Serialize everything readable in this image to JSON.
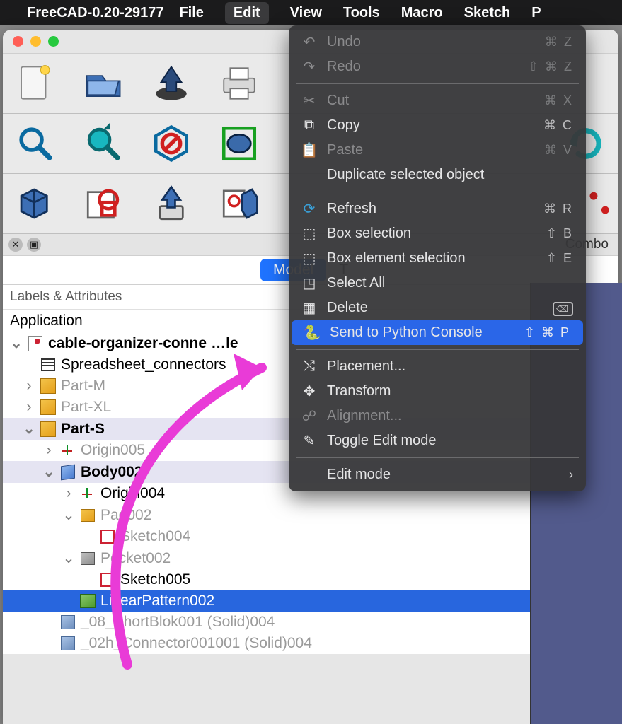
{
  "menubar": {
    "app": "FreeCAD-0.20-29177",
    "items": [
      "File",
      "Edit",
      "View",
      "Tools",
      "Macro",
      "Sketch",
      "P"
    ]
  },
  "panel": {
    "combo_title": "Combo",
    "tabs": {
      "model": "Model",
      "tasks": "T"
    },
    "labels_header": "Labels & Attributes",
    "application": "Application"
  },
  "tree": {
    "doc": "cable-organizer-conne",
    "spreadsheet": "Spreadsheet_connectors",
    "part_m": "Part-M",
    "part_xl": "Part-XL",
    "part_s": "Part-S",
    "origin005": "Origin005",
    "body002": "Body002",
    "origin004": "Origin004",
    "pad002": "Pad002",
    "sketch004": "Sketch004",
    "pocket002": "Pocket002",
    "sketch005": "Sketch005",
    "linpat": "LinearPattern002",
    "solid1": "_08_ShortBlok001 (Solid)004",
    "solid2": "_02h_Connector001001 (Solid)004"
  },
  "edit_menu": {
    "undo": {
      "label": "Undo",
      "sc": "⌘ Z"
    },
    "redo": {
      "label": "Redo",
      "sc": "⇧ ⌘ Z"
    },
    "cut": {
      "label": "Cut",
      "sc": "⌘ X"
    },
    "copy": {
      "label": "Copy",
      "sc": "⌘ C"
    },
    "paste": {
      "label": "Paste",
      "sc": "⌘ V"
    },
    "dup": {
      "label": "Duplicate selected object"
    },
    "refresh": {
      "label": "Refresh",
      "sc": "⌘ R"
    },
    "boxsel": {
      "label": "Box selection",
      "sc": "⇧  B"
    },
    "boxelsel": {
      "label": "Box element selection",
      "sc": "⇧  E"
    },
    "selall": {
      "label": "Select All"
    },
    "delete": {
      "label": "Delete"
    },
    "sendpy": {
      "label": "Send to Python Console",
      "sc": "⇧ ⌘ P"
    },
    "placement": {
      "label": "Placement..."
    },
    "transform": {
      "label": "Transform"
    },
    "alignment": {
      "label": "Alignment..."
    },
    "toggle": {
      "label": "Toggle Edit mode"
    },
    "editmode": {
      "label": "Edit mode"
    }
  }
}
